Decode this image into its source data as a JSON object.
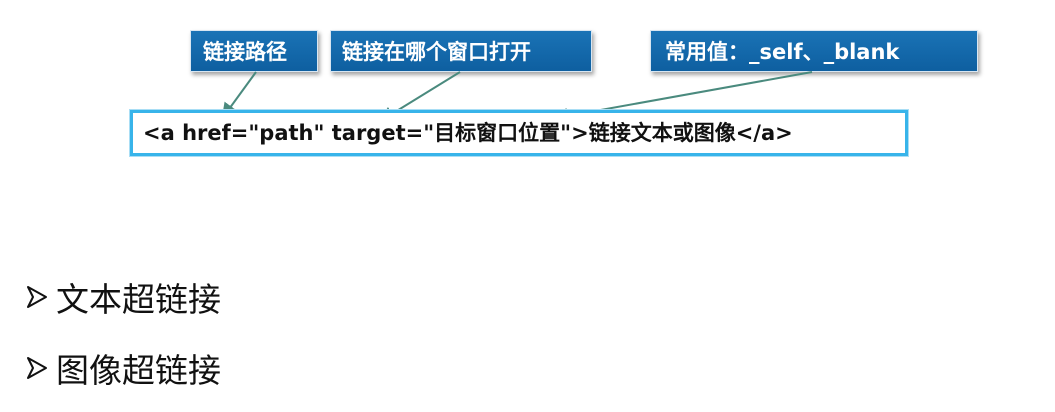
{
  "callouts": {
    "path": "链接路径",
    "target": "链接在哪个窗口打开",
    "values": "常用值：_self、_blank"
  },
  "code": "<a href=\"path\" target=\"目标窗口位置\">链接文本或图像</a>",
  "bullets": [
    {
      "text": "文本超链接",
      "icon": "arrow-bullet-icon"
    },
    {
      "text": "图像超链接",
      "icon": "arrow-bullet-icon"
    }
  ],
  "colors": {
    "callout_bg": "#1a73b6",
    "callout_text": "#ffffff",
    "code_border": "#38b4ea",
    "connector": "#4a8a7e"
  }
}
